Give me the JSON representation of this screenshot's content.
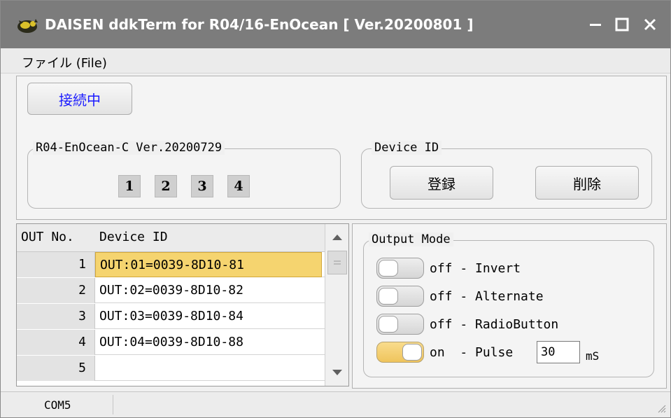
{
  "window": {
    "title": "DAISEN ddkTerm for R04/16-EnOcean [ Ver.20200801 ]"
  },
  "menu": {
    "file": "ファイル (File)"
  },
  "connection": {
    "button_label": "接続中"
  },
  "device_group": {
    "legend": "R04-EnOcean-C Ver.20200729",
    "ports": [
      "1",
      "2",
      "3",
      "4"
    ]
  },
  "device_id_group": {
    "legend": "Device ID",
    "register_label": "登録",
    "delete_label": "削除"
  },
  "table": {
    "headers": [
      "OUT No.",
      "Device ID"
    ],
    "rows": [
      {
        "num": "1",
        "id": "OUT:01=0039-8D10-81",
        "selected": true
      },
      {
        "num": "2",
        "id": "OUT:02=0039-8D10-82",
        "selected": false
      },
      {
        "num": "3",
        "id": "OUT:03=0039-8D10-84",
        "selected": false
      },
      {
        "num": "4",
        "id": "OUT:04=0039-8D10-88",
        "selected": false
      },
      {
        "num": "5",
        "id": "",
        "selected": false
      }
    ]
  },
  "output_mode": {
    "legend": "Output Mode",
    "items": [
      {
        "label": "off - Invert",
        "state": "off"
      },
      {
        "label": "off - Alternate",
        "state": "off"
      },
      {
        "label": "off - RadioButton",
        "state": "off"
      },
      {
        "label": "on  - Pulse",
        "state": "on"
      }
    ],
    "pulse_value": "30",
    "pulse_unit": "mS"
  },
  "status": {
    "port": "COM5"
  },
  "colors": {
    "titlebar": "#7c7c7c",
    "selected_row": "#f5d46f",
    "toggle_on": "#efc45c",
    "connect_text": "#1a1aff"
  }
}
